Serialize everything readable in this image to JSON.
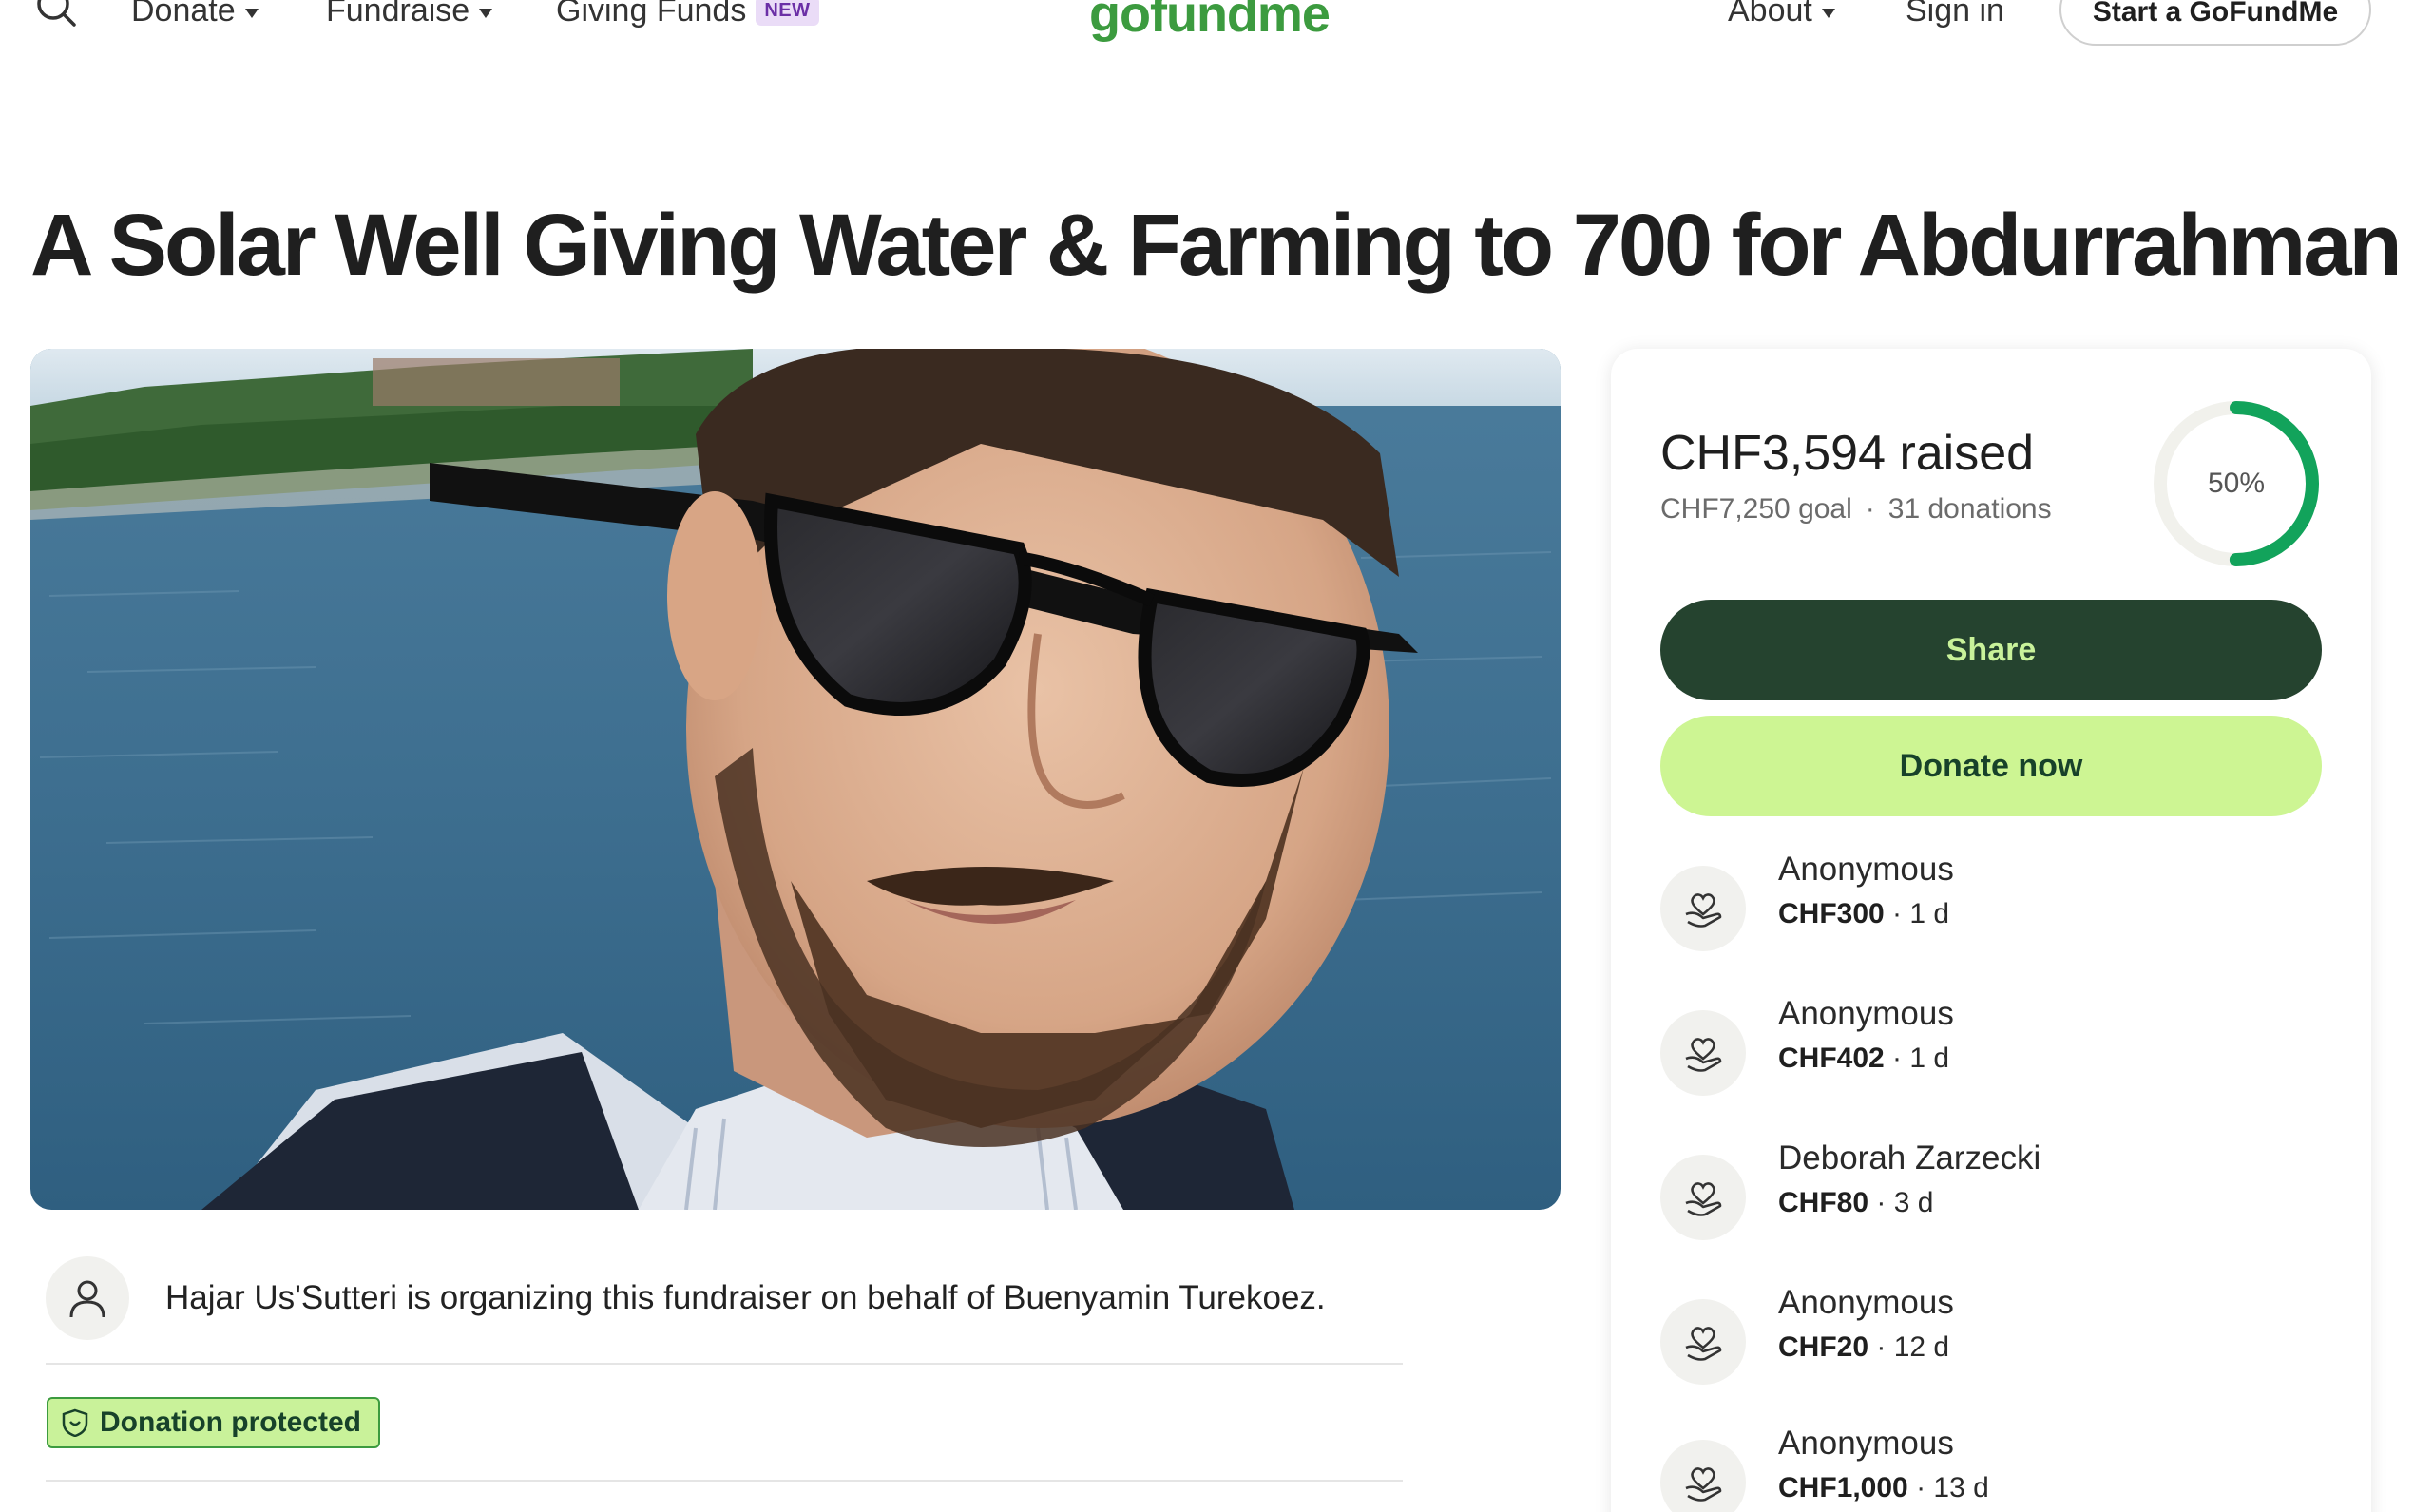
{
  "header": {
    "nav": {
      "donate": "Donate",
      "fundraise": "Fundraise",
      "giving_funds": "Giving Funds",
      "new_badge": "NEW",
      "about": "About",
      "sign_in": "Sign in"
    },
    "logo": "gofundme",
    "start_button": "Start a GoFundMe",
    "icons": [
      "search-icon",
      "chevron-down-icon"
    ]
  },
  "campaign": {
    "title": "A Solar Well Giving Water & Farming to 700 for Abdurrahman",
    "organizer_text": "Hajar Us'Sutteri is organizing this fundraiser on behalf of Buenyamin Turekoez.",
    "protected_label": "Donation protected"
  },
  "stats": {
    "raised": "CHF3,594 raised",
    "goal": "CHF7,250 goal",
    "separator": "·",
    "donations": "31 donations",
    "progress_label": "50%",
    "progress_fraction": 0.5
  },
  "actions": {
    "share": "Share",
    "donate_now": "Donate now"
  },
  "donations": [
    {
      "name": "Anonymous",
      "amount": "CHF300",
      "time": " · 1 d"
    },
    {
      "name": "Anonymous",
      "amount": "CHF402",
      "time": " · 1 d"
    },
    {
      "name": "Deborah Zarzecki",
      "amount": "CHF80",
      "time": " · 3 d"
    },
    {
      "name": "Anonymous",
      "amount": "CHF20",
      "time": " · 12 d"
    },
    {
      "name": "Anonymous",
      "amount": "CHF1,000",
      "time": " · 13 d"
    }
  ],
  "colors": {
    "brand_green": "#3c9b3f",
    "share_bg": "#25432f",
    "donate_bg": "#cdf593",
    "progress": "#12a35b"
  }
}
